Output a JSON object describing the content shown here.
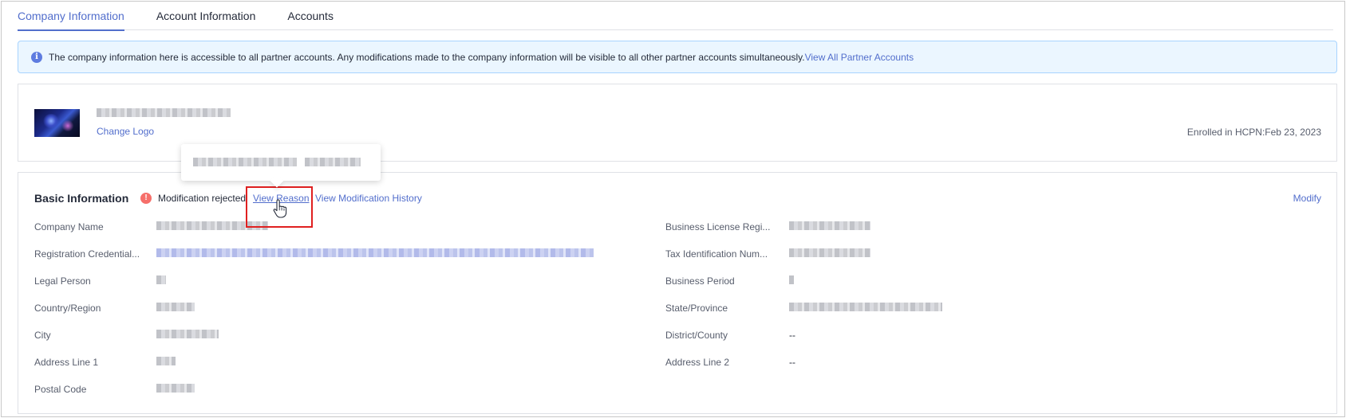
{
  "tabs": [
    {
      "label": "Company Information",
      "active": true
    },
    {
      "label": "Account Information",
      "active": false
    },
    {
      "label": "Accounts",
      "active": false
    }
  ],
  "notice": {
    "text": "The company information here is accessible to all partner accounts. Any modifications made to the company information will be visible to all other partner accounts simultaneously.",
    "link": "View All Partner Accounts",
    "icon": "info-icon"
  },
  "company": {
    "change_logo": "Change Logo",
    "enrolled": "Enrolled in HCPN:Feb 23, 2023"
  },
  "basic": {
    "title": "Basic Information",
    "status": "Modification rejected",
    "view_reason": "View Reason",
    "view_history": "View Modification History",
    "modify": "Modify",
    "fields_left": [
      {
        "label": "Company Name"
      },
      {
        "label": "Registration Credential..."
      },
      {
        "label": "Legal Person"
      },
      {
        "label": "Country/Region"
      },
      {
        "label": "City"
      },
      {
        "label": "Address Line 1"
      },
      {
        "label": "Postal Code"
      }
    ],
    "fields_right": [
      {
        "label": "Business License Regi..."
      },
      {
        "label": "Tax Identification Num..."
      },
      {
        "label": "Business Period"
      },
      {
        "label": "State/Province"
      },
      {
        "label": "District/County",
        "value": "--"
      },
      {
        "label": "Address Line 2",
        "value": "--"
      }
    ]
  },
  "colors": {
    "accent": "#526ecc",
    "notice_bg": "#ebf6ff",
    "warning": "#f66f6a",
    "highlight": "#e02020"
  }
}
